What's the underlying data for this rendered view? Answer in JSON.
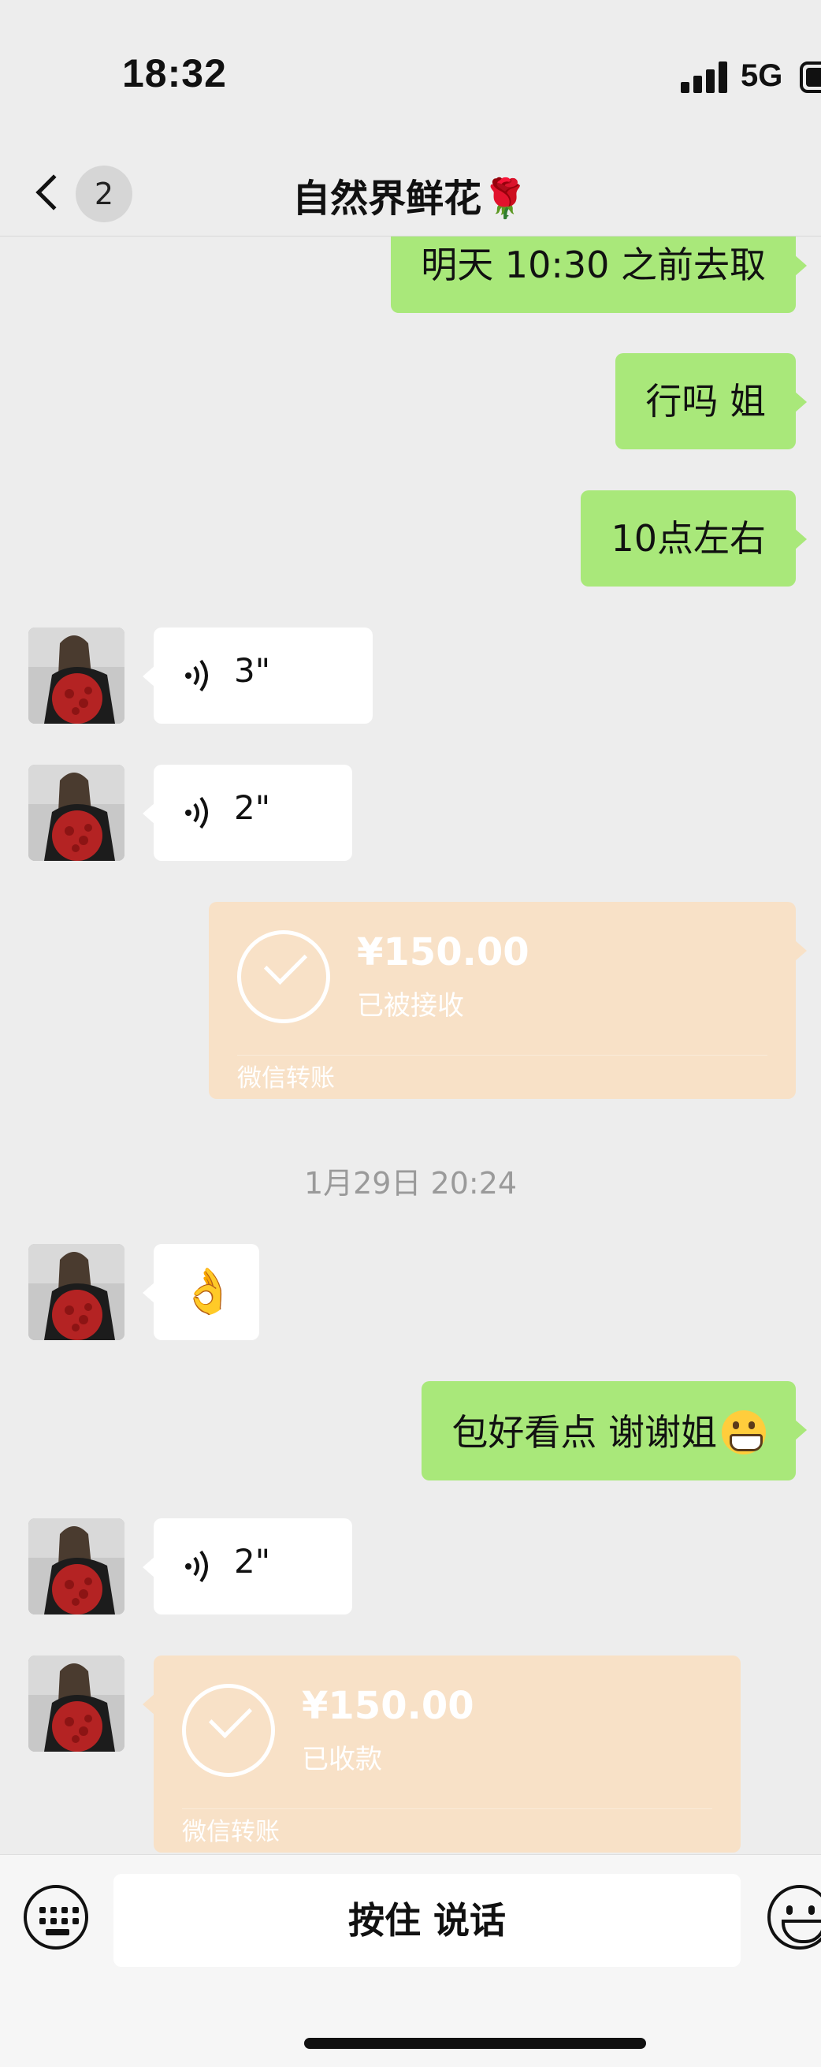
{
  "status_bar": {
    "time": "18:32",
    "network": "5G"
  },
  "header": {
    "back_badge": "2",
    "title": "自然界鲜花🌹"
  },
  "messages": {
    "m1": "明天 10:30 之前去取",
    "m2": "行吗 姐",
    "m3": "10点左右",
    "voice1": "3\"",
    "voice2": "2\"",
    "transfer1": {
      "amount": "¥150.00",
      "status": "已被接收",
      "label": "微信转账"
    },
    "timestamp": "1月29日 20:24",
    "ok_emoji": "👌",
    "m4": "包好看点 谢谢姐",
    "voice3": "2\"",
    "transfer2": {
      "amount": "¥150.00",
      "status": "已收款",
      "label": "微信转账"
    }
  },
  "input_bar": {
    "hold_to_talk": "按住 说话"
  },
  "colors": {
    "outgoing_bubble": "#a9e87a",
    "transfer_card": "#f8e1c7",
    "background": "#ededed"
  },
  "icons": [
    "back-chevron-icon",
    "voice-wave-icon",
    "check-circle-icon",
    "keyboard-icon",
    "emoji-face-icon"
  ]
}
